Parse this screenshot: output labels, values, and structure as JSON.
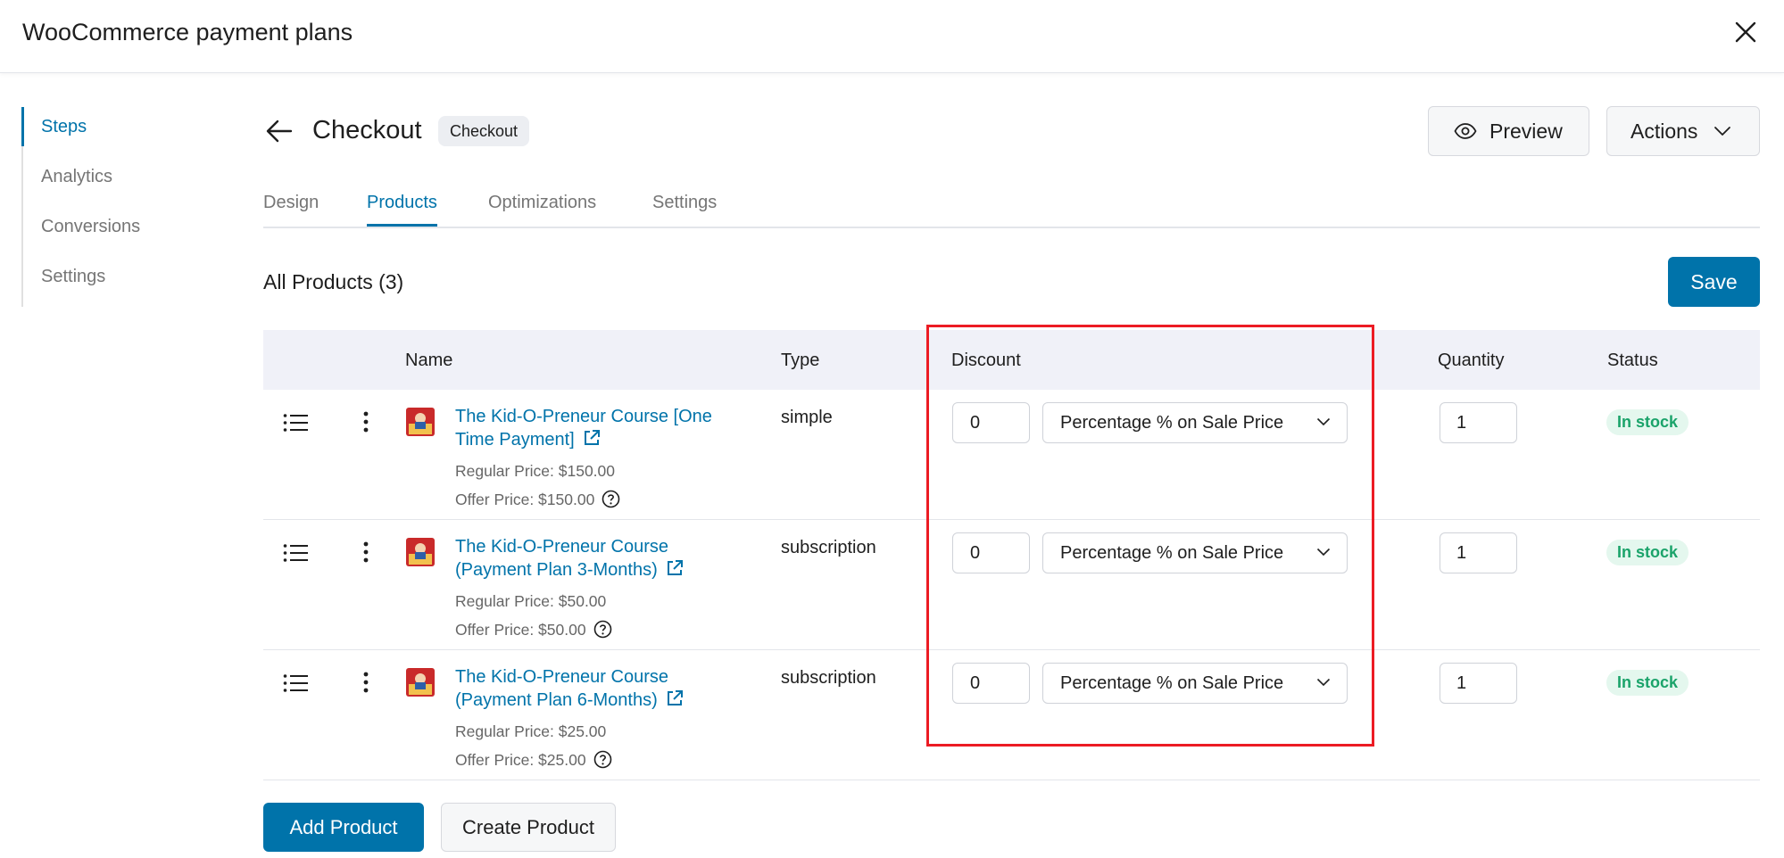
{
  "window": {
    "title": "WooCommerce payment plans"
  },
  "sidebar": {
    "items": [
      {
        "label": "Steps",
        "active": true
      },
      {
        "label": "Analytics",
        "active": false
      },
      {
        "label": "Conversions",
        "active": false
      },
      {
        "label": "Settings",
        "active": false
      }
    ]
  },
  "header": {
    "title": "Checkout",
    "badge": "Checkout",
    "preview_label": "Preview",
    "actions_label": "Actions"
  },
  "tabs": [
    {
      "label": "Design",
      "active": false
    },
    {
      "label": "Products",
      "active": true
    },
    {
      "label": "Optimizations",
      "active": false
    },
    {
      "label": "Settings",
      "active": false
    }
  ],
  "products_section": {
    "title": "All Products (3)",
    "save_label": "Save"
  },
  "table": {
    "columns": [
      "Name",
      "Type",
      "Discount",
      "Quantity",
      "Status"
    ],
    "rows": [
      {
        "name": "The Kid-O-Preneur Course [One Time Payment]",
        "regular_price": "Regular Price: $150.00",
        "offer_price": "Offer Price: $150.00",
        "type": "simple",
        "discount_value": "0",
        "discount_type": "Percentage % on Sale Price",
        "quantity": "1",
        "status": "In stock"
      },
      {
        "name": "The Kid-O-Preneur Course (Payment Plan 3-Months)",
        "regular_price": "Regular Price: $50.00",
        "offer_price": "Offer Price: $50.00",
        "type": "subscription",
        "discount_value": "0",
        "discount_type": "Percentage % on Sale Price",
        "quantity": "1",
        "status": "In stock"
      },
      {
        "name": "The Kid-O-Preneur Course (Payment Plan 6-Months)",
        "regular_price": "Regular Price: $25.00",
        "offer_price": "Offer Price: $25.00",
        "type": "subscription",
        "discount_value": "0",
        "discount_type": "Percentage % on Sale Price",
        "quantity": "1",
        "status": "In stock"
      }
    ]
  },
  "footer": {
    "add_product_label": "Add Product",
    "create_product_label": "Create Product"
  },
  "icons": {
    "close": "close-icon",
    "back": "arrow-left-icon",
    "preview": "eye-icon",
    "actions": "chevron-down-icon",
    "drag": "list-icon",
    "more": "vertical-dots-icon",
    "external": "external-link-icon",
    "help": "question-circle-icon"
  },
  "colors": {
    "accent": "#0073aa",
    "stock_badge_bg": "#e4f7ee",
    "stock_badge_text": "#1aa36a",
    "highlight": "#ec1c24",
    "table_header_bg": "#f0f1f8"
  }
}
